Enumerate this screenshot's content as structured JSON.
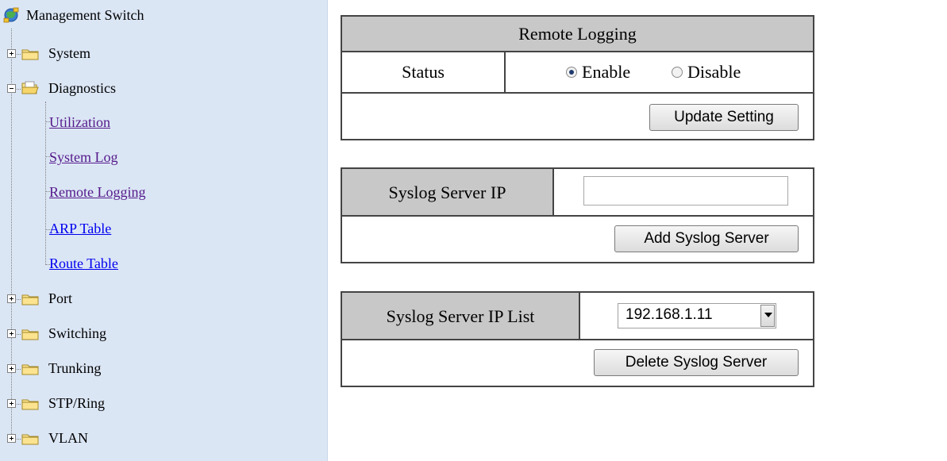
{
  "sidebar": {
    "root_label": "Management Switch",
    "items": [
      {
        "label": "System",
        "state": "collapsed"
      },
      {
        "label": "Diagnostics",
        "state": "expanded",
        "children": [
          "Utilization",
          "System Log",
          "Remote Logging",
          "ARP Table",
          "Route Table"
        ]
      },
      {
        "label": "Port",
        "state": "collapsed"
      },
      {
        "label": "Switching",
        "state": "collapsed"
      },
      {
        "label": "Trunking",
        "state": "collapsed"
      },
      {
        "label": "STP/Ring",
        "state": "collapsed"
      },
      {
        "label": "VLAN",
        "state": "collapsed"
      }
    ]
  },
  "remote_logging": {
    "title": "Remote Logging",
    "status_label": "Status",
    "enable_label": "Enable",
    "disable_label": "Disable",
    "selected": "Enable",
    "update_button": "Update Setting"
  },
  "syslog_server": {
    "label": "Syslog Server IP",
    "value": "",
    "add_button": "Add Syslog Server"
  },
  "syslog_list": {
    "label": "Syslog Server IP List",
    "selected": "192.168.1.11",
    "delete_button": "Delete Syslog Server"
  },
  "colors": {
    "sidebar_bg": "#dbe6f5",
    "header_bg": "#c8c8c8",
    "visited_link": "#551a8b",
    "link": "#0000ee"
  }
}
